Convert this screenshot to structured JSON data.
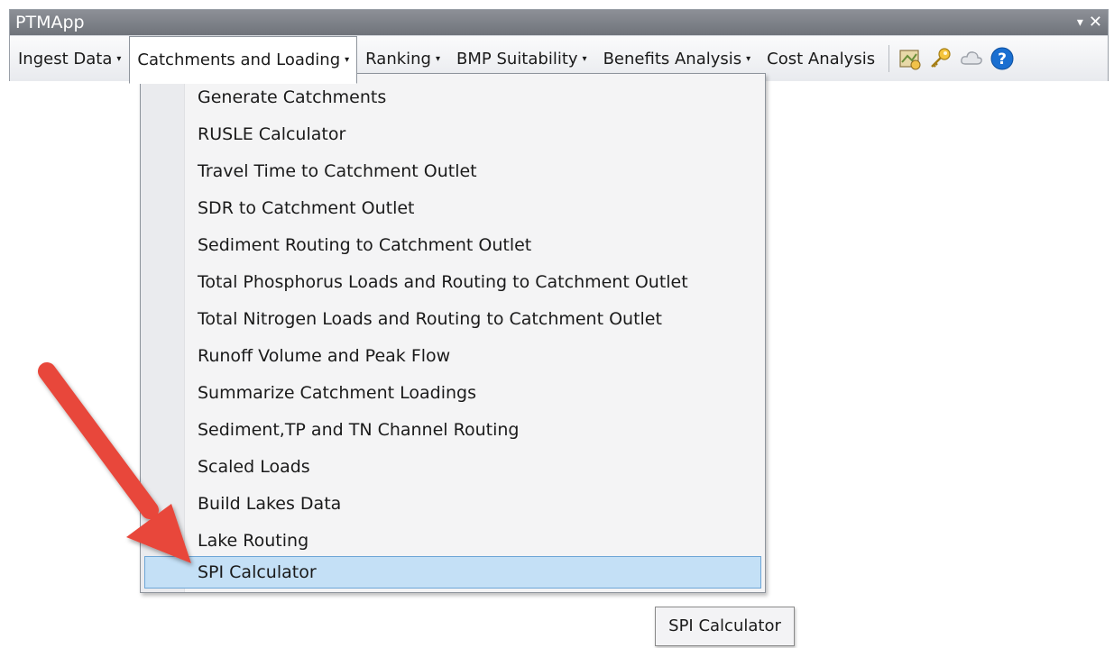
{
  "window": {
    "title": "PTMApp",
    "dropdown_glyph": "▾",
    "close_glyph": "✕"
  },
  "menubar": {
    "caret": "▾",
    "items": [
      {
        "label": "Ingest Data"
      },
      {
        "label": "Catchments and Loading"
      },
      {
        "label": "Ranking"
      },
      {
        "label": "BMP Suitability"
      },
      {
        "label": "Benefits Analysis"
      },
      {
        "label": "Cost Analysis"
      }
    ],
    "tools": [
      "map-tool-icon",
      "key-icon",
      "cloud-icon",
      "help-icon"
    ]
  },
  "dropdown": {
    "items": [
      {
        "label": "Generate Catchments"
      },
      {
        "label": "RUSLE Calculator"
      },
      {
        "label": "Travel Time to Catchment Outlet"
      },
      {
        "label": "SDR to Catchment Outlet"
      },
      {
        "label": "Sediment Routing to Catchment Outlet"
      },
      {
        "label": "Total Phosphorus Loads and Routing to Catchment Outlet"
      },
      {
        "label": "Total Nitrogen Loads and Routing to Catchment Outlet"
      },
      {
        "label": "Runoff Volume and Peak Flow"
      },
      {
        "label": "Summarize Catchment Loadings"
      },
      {
        "label": "Sediment,TP and TN Channel Routing"
      },
      {
        "label": "Scaled Loads"
      },
      {
        "label": "Build Lakes Data"
      },
      {
        "label": "Lake Routing"
      },
      {
        "label": "SPI Calculator"
      }
    ],
    "highlighted": "SPI Calculator"
  },
  "tooltip": {
    "text": "SPI Calculator"
  },
  "colors": {
    "highlight": "#c4e0f6",
    "arrow": "#e8473a",
    "help": "#1a6fd1"
  }
}
